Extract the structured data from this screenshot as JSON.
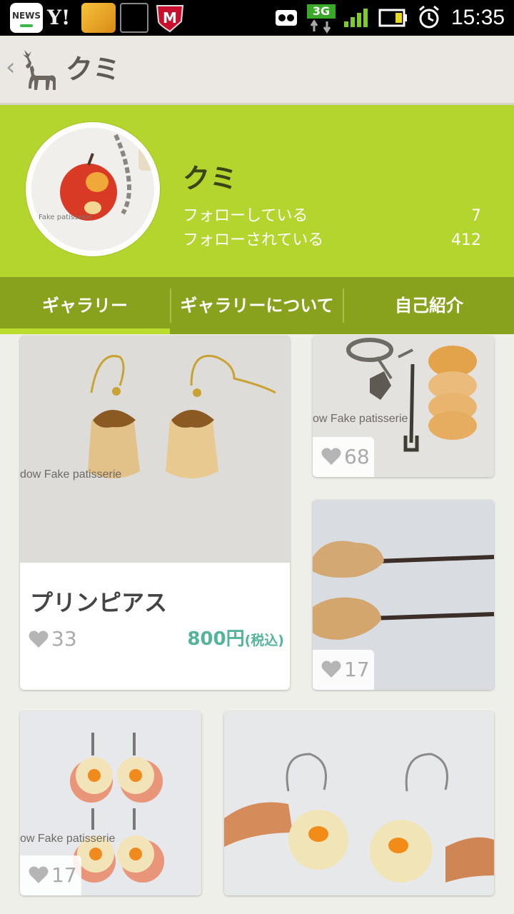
{
  "status_bar": {
    "news_label": "NEWS",
    "yahoo_label": "Y!",
    "network_label": "3G",
    "time": "15:35"
  },
  "action_bar": {
    "title": "クミ"
  },
  "profile": {
    "name": "クミ",
    "following_label": "フォローしている",
    "following_count": "7",
    "followers_label": "フォローされている",
    "followers_count": "412"
  },
  "tabs": [
    {
      "label": "ギャラリー",
      "selected": true
    },
    {
      "label": "ギャラリーについて",
      "selected": false
    },
    {
      "label": "自己紹介",
      "selected": false
    }
  ],
  "gallery": [
    {
      "title": "プリンピアス",
      "likes": "33",
      "price": "800円",
      "tax_note": "(税込)",
      "watermark": "dow Fake patisserie"
    },
    {
      "likes": "68",
      "watermark": "ow Fake patisserie"
    },
    {
      "likes": "17"
    },
    {
      "likes": "17",
      "watermark": "ow Fake patisserie"
    },
    {}
  ],
  "avatar_caption": "Fake patisserie",
  "colors": {
    "profile_bg": "#b3d52d",
    "tabs_bg": "#89a21d",
    "price": "#54b49b",
    "action_bar_bg": "#ebe8e3"
  }
}
